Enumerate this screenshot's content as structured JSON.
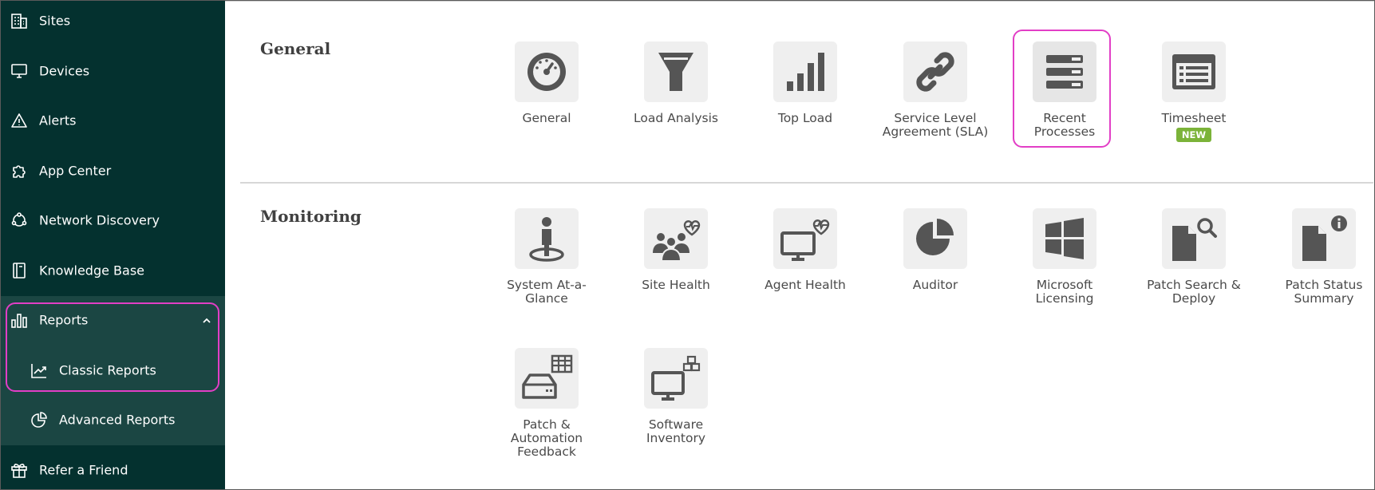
{
  "sidebar": {
    "items": [
      {
        "label": "Sites",
        "icon": "building-icon"
      },
      {
        "label": "Devices",
        "icon": "monitor-icon"
      },
      {
        "label": "Alerts",
        "icon": "alert-triangle-icon"
      },
      {
        "label": "App Center",
        "icon": "puzzle-icon"
      },
      {
        "label": "Network Discovery",
        "icon": "network-icon"
      },
      {
        "label": "Knowledge Base",
        "icon": "book-icon"
      },
      {
        "label": "Reports",
        "icon": "bar-chart-icon",
        "expanded": true
      },
      {
        "label": "Classic Reports",
        "icon": "line-chart-icon"
      },
      {
        "label": "Advanced Reports",
        "icon": "pie-chart-icon"
      },
      {
        "label": "Refer a Friend",
        "icon": "gift-icon"
      }
    ]
  },
  "sections": [
    {
      "title": "General",
      "tiles": [
        {
          "label": "General",
          "icon": "gauge-icon"
        },
        {
          "label": "Load Analysis",
          "icon": "funnel-icon"
        },
        {
          "label": "Top Load",
          "icon": "signal-bars-icon"
        },
        {
          "label": "Service Level Agreement (SLA)",
          "icon": "link-icon"
        },
        {
          "label": "Recent Processes",
          "icon": "process-list-icon"
        },
        {
          "label": "Timesheet",
          "icon": "timesheet-icon",
          "badge": "NEW"
        }
      ]
    },
    {
      "title": "Monitoring",
      "tiles": [
        {
          "label": "System At-a-Glance",
          "icon": "person-pin-icon"
        },
        {
          "label": "Site Health",
          "icon": "group-heart-icon"
        },
        {
          "label": "Agent Health",
          "icon": "monitor-heart-icon"
        },
        {
          "label": "Auditor",
          "icon": "pie-chart-icon"
        },
        {
          "label": "Microsoft Licensing",
          "icon": "windows-icon"
        },
        {
          "label": "Patch Search & Deploy",
          "icon": "doc-search-icon"
        },
        {
          "label": "Patch Status Summary",
          "icon": "doc-info-icon"
        },
        {
          "label": "Patch & Automation Feedback",
          "icon": "drive-table-icon"
        },
        {
          "label": "Software Inventory",
          "icon": "monitor-boxes-icon"
        }
      ]
    }
  ],
  "colors": {
    "sidebar_bg": "#04312f",
    "sidebar_sub_bg": "#1b4643",
    "highlight": "#e23ec6",
    "icon_gray": "#555555",
    "tile_bg": "#efefef",
    "badge_green": "#7bb339"
  }
}
